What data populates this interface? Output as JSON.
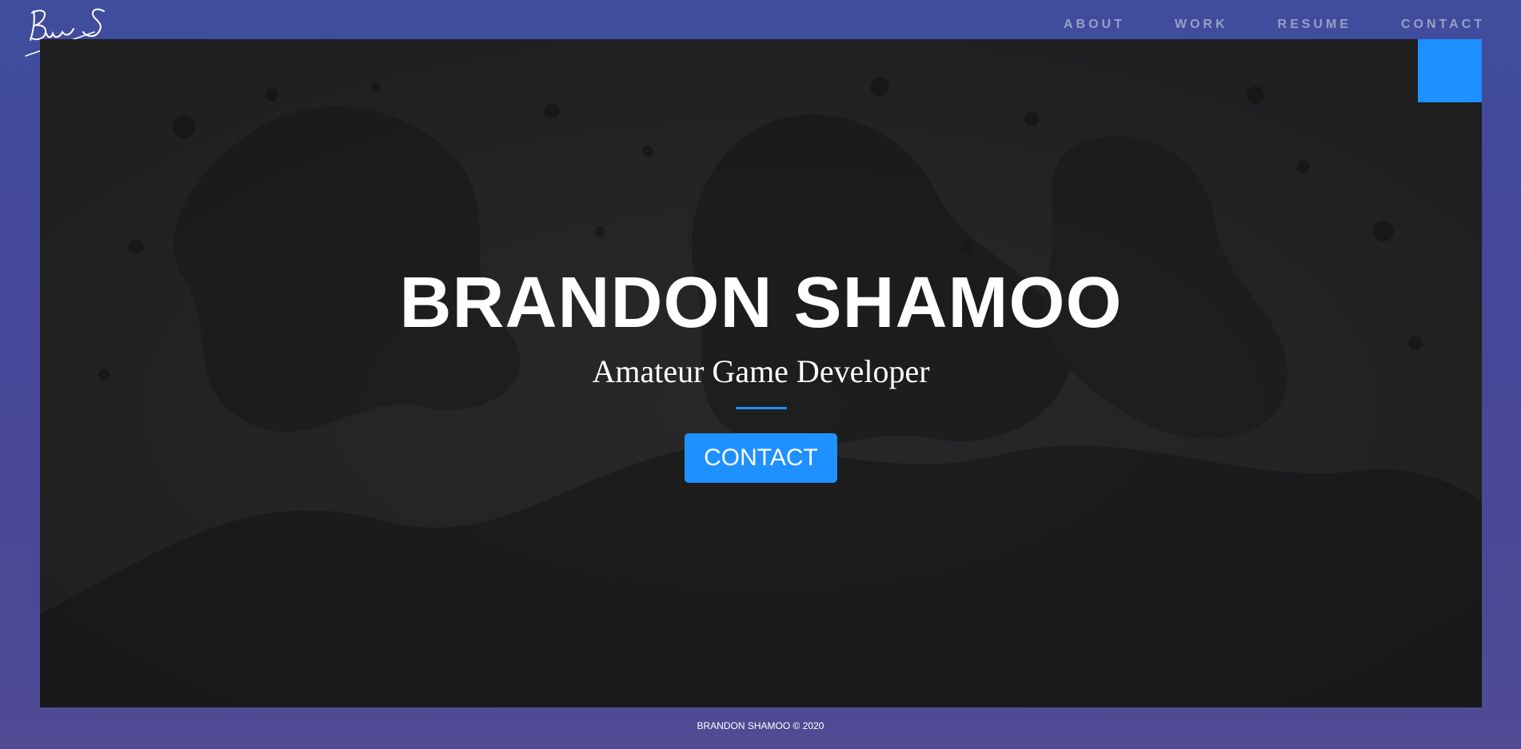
{
  "nav": {
    "items": [
      {
        "label": "ABOUT"
      },
      {
        "label": "WORK"
      },
      {
        "label": "RESUME"
      },
      {
        "label": "CONTACT"
      }
    ]
  },
  "hero": {
    "title": "BRANDON SHAMOO",
    "subtitle": "Amateur Game Developer",
    "button_label": "CONTACT"
  },
  "footer": {
    "text": "BRANDON SHAMOO © 2020"
  },
  "colors": {
    "accent": "#1e90ff",
    "background": "#44479a",
    "hero_overlay": "#2a2a2b"
  }
}
